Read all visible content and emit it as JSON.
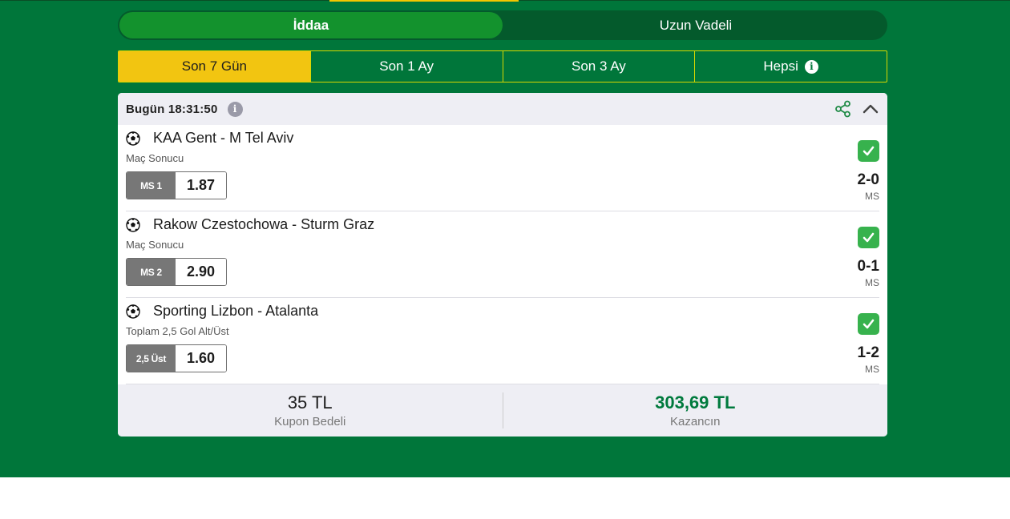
{
  "main_tabs": [
    {
      "label": "İddaa",
      "active": true
    },
    {
      "label": "Uzun Vadeli",
      "active": false
    }
  ],
  "period_tabs": [
    {
      "label": "Son 7 Gün",
      "active": true
    },
    {
      "label": "Son 1 Ay",
      "active": false
    },
    {
      "label": "Son 3 Ay",
      "active": false
    },
    {
      "label": "Hepsi",
      "active": false,
      "icon": "info-icon"
    }
  ],
  "info_glyph": "i",
  "coupon": {
    "date": "Bugün 18:31:50",
    "header_icons": [
      "info-icon",
      "share-icon",
      "chevron-up-icon"
    ],
    "matches": [
      {
        "title": "KAA Gent - M Tel Aviv",
        "bet_type": "Maç Sonucu",
        "pick": "MS 1",
        "odds": "1.87",
        "score": "2-0",
        "score_label": "MS",
        "status": "won"
      },
      {
        "title": "Rakow Czestochowa - Sturm Graz",
        "bet_type": "Maç Sonucu",
        "pick": "MS 2",
        "odds": "2.90",
        "score": "0-1",
        "score_label": "MS",
        "status": "won"
      },
      {
        "title": "Sporting Lizbon - Atalanta",
        "bet_type": "Toplam 2,5 Gol Alt/Üst",
        "pick": "2,5 Üst",
        "odds": "1.60",
        "score": "1-2",
        "score_label": "MS",
        "status": "won"
      }
    ],
    "stake": {
      "amount": "35 TL",
      "label": "Kupon Bedeli"
    },
    "winnings": {
      "amount": "303,69 TL",
      "label": "Kazancın"
    }
  },
  "colors": {
    "background_green": "#00763a",
    "active_tab_green": "#13922d",
    "period_active_yellow": "#f2c511",
    "win_green": "#007a3d",
    "check_green": "#37b24d"
  }
}
